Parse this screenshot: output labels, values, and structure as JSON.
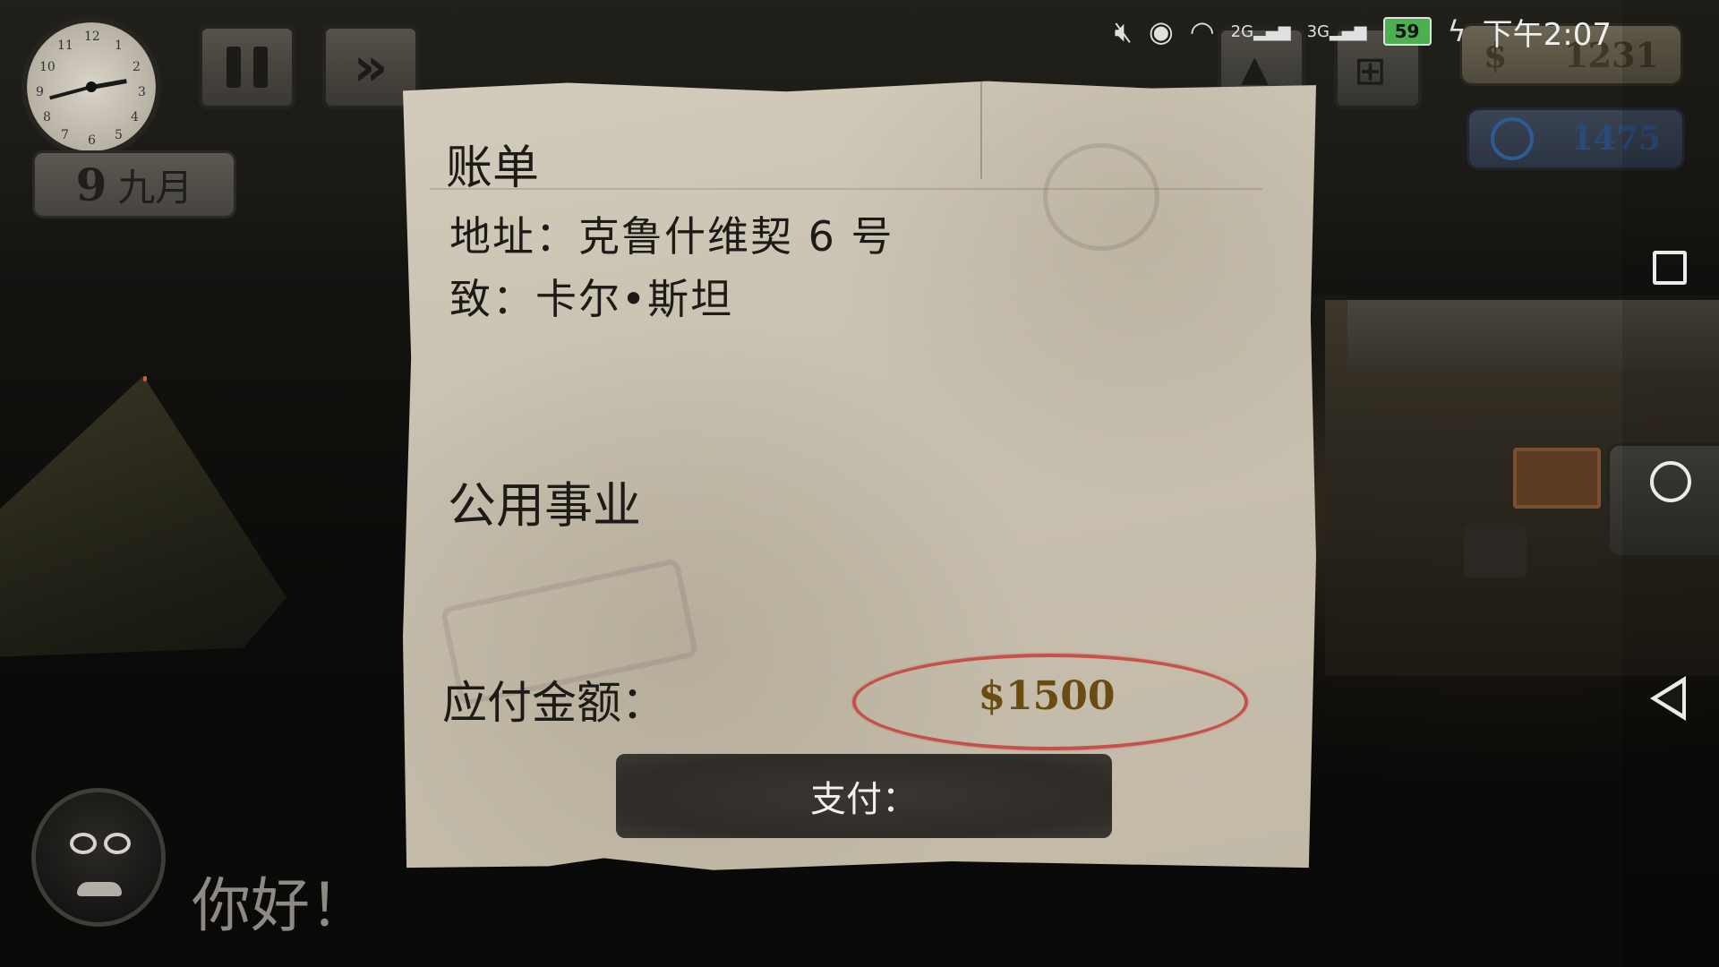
{
  "hud": {
    "date_day": "9",
    "date_month": "九月",
    "money": "1231",
    "money_symbol": "$",
    "reputation": "1475",
    "clock_numbers": [
      "12",
      "1",
      "2",
      "3",
      "4",
      "5",
      "6",
      "7",
      "8",
      "9",
      "10",
      "11"
    ]
  },
  "status_bar": {
    "network_1": "2G",
    "network_2": "3G",
    "battery": "59",
    "time": "下午2:07"
  },
  "bill": {
    "title": "账单",
    "address": "地址：克鲁什维契 6 号",
    "to": "致：卡尔•斯坦",
    "category": "公用事业",
    "due_label": "应付金额：",
    "amount": "$1500",
    "pay_label": "支付："
  },
  "dialog": {
    "greeting": "你好！"
  },
  "icons": {
    "mute": "mute-icon",
    "eye": "eye-icon",
    "wifi": "wifi-icon",
    "signal": "signal-icon",
    "charging": "charging-icon"
  },
  "colors": {
    "paper": "#c9c1b0",
    "amount_oval": "#c62e2e",
    "amount_text": "#6a4b12",
    "pay_button": "#2f2c28"
  }
}
